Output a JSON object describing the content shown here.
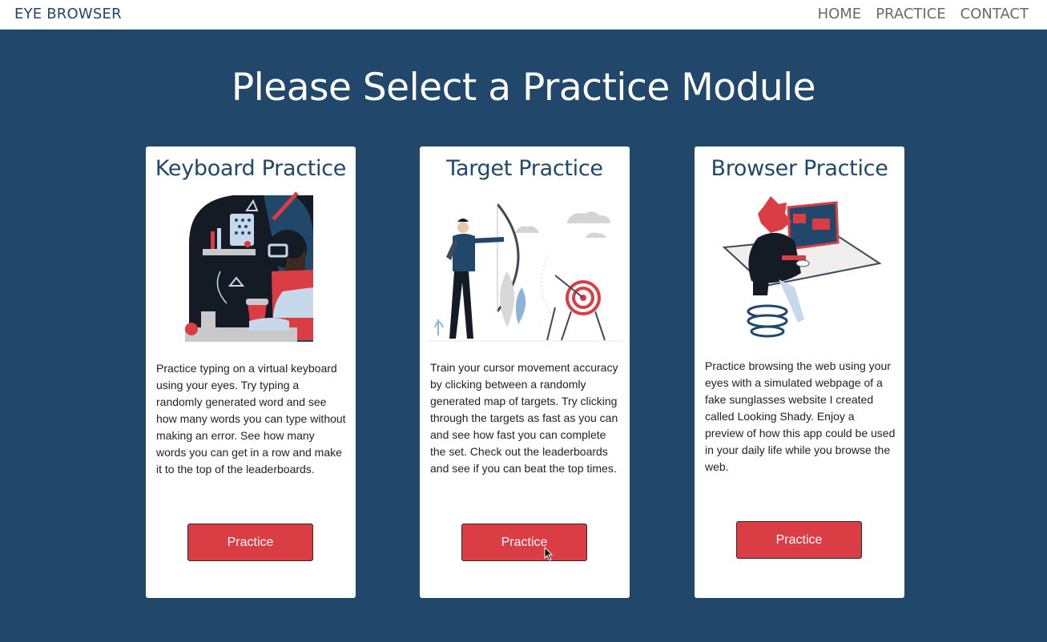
{
  "navbar": {
    "brand": "EYE BROWSER",
    "links": [
      "HOME",
      "PRACTICE",
      "CONTACT"
    ]
  },
  "page": {
    "title": "Please Select a Practice Module"
  },
  "colors": {
    "background": "#21476a",
    "accent_red": "#db3d44",
    "card_bg": "#ffffff",
    "title_blue": "#21476a"
  },
  "cards": [
    {
      "title": "Keyboard Practice",
      "illustration": "typing-person-illustration",
      "description": "Practice typing on a virtual keyboard using your eyes. Try typing a randomly generated word and see how many words you can type without making an error. See how many words you can get in a row and make it to the top of the leaderboards.",
      "button_label": "Practice"
    },
    {
      "title": "Target Practice",
      "illustration": "archer-target-illustration",
      "description": "Train your cursor movement accuracy by clicking between a randomly generated map of targets. Try clicking through the targets as fast as you can and see how fast you can complete the set. Check out the leaderboards and see if you can beat the top times.",
      "button_label": "Practice"
    },
    {
      "title": "Browser Practice",
      "illustration": "person-at-computer-illustration",
      "description": "Practice browsing the web using your eyes with a simulated webpage of a fake sunglasses website I created called Looking Shady. Enjoy a preview of how this app could be used in your daily life while you browse the web.",
      "button_label": "Practice"
    }
  ]
}
